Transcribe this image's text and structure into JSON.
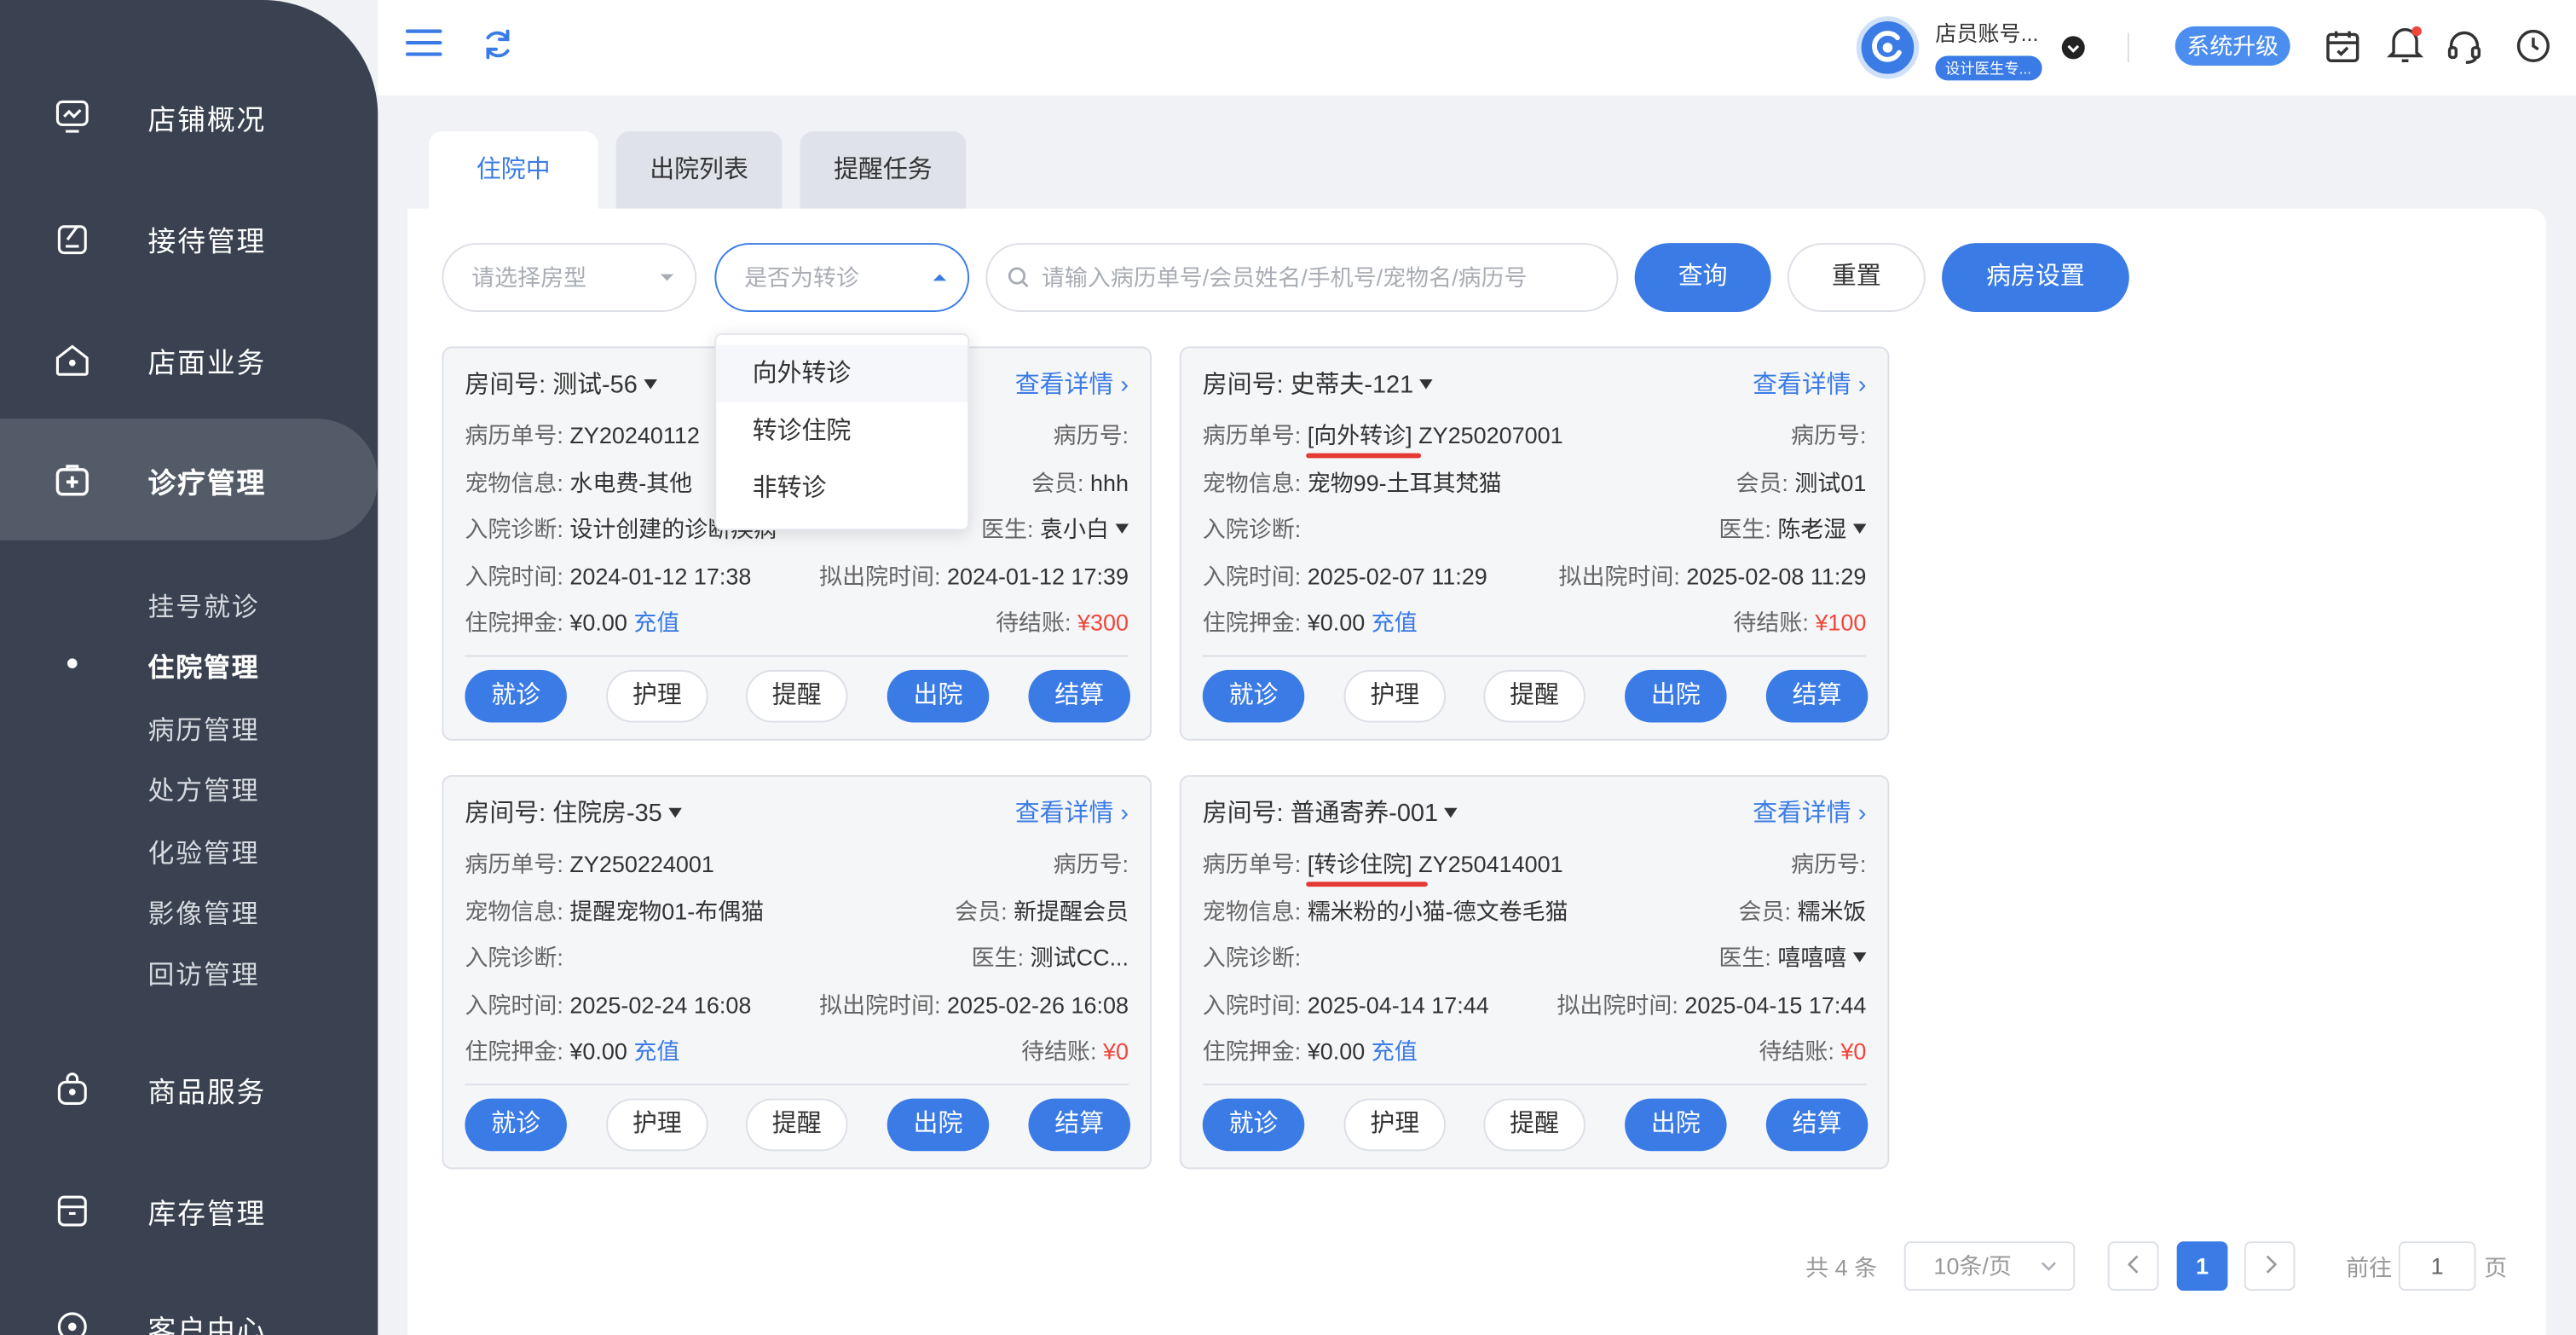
{
  "sidebar": {
    "items": [
      {
        "label": "店铺概况",
        "icon": "dashboard-icon"
      },
      {
        "label": "接待管理",
        "icon": "reception-icon"
      },
      {
        "label": "店面业务",
        "icon": "store-icon"
      },
      {
        "label": "诊疗管理",
        "icon": "medical-kit-icon"
      },
      {
        "label": "商品服务",
        "icon": "shopping-bag-icon"
      },
      {
        "label": "库存管理",
        "icon": "inventory-box-icon"
      },
      {
        "label": "客户中心",
        "icon": "customer-icon"
      }
    ],
    "subitems": [
      "挂号就诊",
      "住院管理",
      "病历管理",
      "处方管理",
      "化验管理",
      "影像管理",
      "回访管理"
    ],
    "active_sub": "住院管理"
  },
  "header": {
    "account_name": "店员账号...",
    "account_tag": "设计医生专...",
    "upgrade_label": "系统升级"
  },
  "tabs": [
    "住院中",
    "出院列表",
    "提醒任务"
  ],
  "filters": {
    "room_type_placeholder": "请选择房型",
    "transfer_placeholder": "是否为转诊",
    "search_placeholder": "请输入病历单号/会员姓名/手机号/宠物名/病历号",
    "query_label": "查询",
    "reset_label": "重置",
    "ward_settings_label": "病房设置"
  },
  "transfer_dropdown": {
    "options": [
      "向外转诊",
      "转诊住院",
      "非转诊"
    ],
    "highlighted": "向外转诊"
  },
  "field_labels": {
    "room": "房间号:",
    "case_no": "病历单号:",
    "record_no": "病历号:",
    "pet_info": "宠物信息:",
    "member": "会员:",
    "diagnosis": "入院诊断:",
    "doctor": "医生:",
    "admit_time": "入院时间:",
    "planned_discharge": "拟出院时间:",
    "deposit": "住院押金:",
    "pending": "待结账:",
    "recharge": "充值",
    "details": "查看详情"
  },
  "card_buttons": [
    "就诊",
    "护理",
    "提醒",
    "出院",
    "结算"
  ],
  "cards": [
    {
      "room": "测试-56",
      "case_no": "ZY20240112",
      "pet_info": "水电费-其他",
      "member": "hhh",
      "diagnosis": "设计创建的诊断疾病",
      "doctor": "袁小白",
      "admit_time": "2024-01-12 17:38",
      "discharge_time": "2024-01-12 17:39",
      "deposit": "¥0.00",
      "pending": "¥300"
    },
    {
      "room": "史蒂夫-121",
      "case_no": "[向外转诊] ZY250207001",
      "pet_info": "宠物99-土耳其梵猫",
      "member": "测试01",
      "diagnosis": "",
      "doctor": "陈老湿",
      "admit_time": "2025-02-07 11:29",
      "discharge_time": "2025-02-08 11:29",
      "deposit": "¥0.00",
      "pending": "¥100"
    },
    {
      "room": "住院房-35",
      "case_no": "ZY250224001",
      "pet_info": "提醒宠物01-布偶猫",
      "member": "新提醒会员",
      "diagnosis": "",
      "doctor": "测试CC...",
      "admit_time": "2025-02-24 16:08",
      "discharge_time": "2025-02-26 16:08",
      "deposit": "¥0.00",
      "pending": "¥0"
    },
    {
      "room": "普通寄养-001",
      "case_no": "[转诊住院] ZY250414001",
      "pet_info": "糯米粉的小猫-德文卷毛猫",
      "member": "糯米饭",
      "diagnosis": "",
      "doctor": "嘻嘻嘻",
      "admit_time": "2025-04-14 17:44",
      "discharge_time": "2025-04-15 17:44",
      "deposit": "¥0.00",
      "pending": "¥0"
    }
  ],
  "pagination": {
    "total": "共 4 条",
    "page_size": "10条/页",
    "current_page": "1",
    "goto_prefix": "前往",
    "goto_value": "1",
    "goto_suffix": "页"
  },
  "colors": {
    "primary": "#3a7be6",
    "sidebar": "#3a4150",
    "danger": "#f0453a",
    "underline": "#e53935"
  }
}
